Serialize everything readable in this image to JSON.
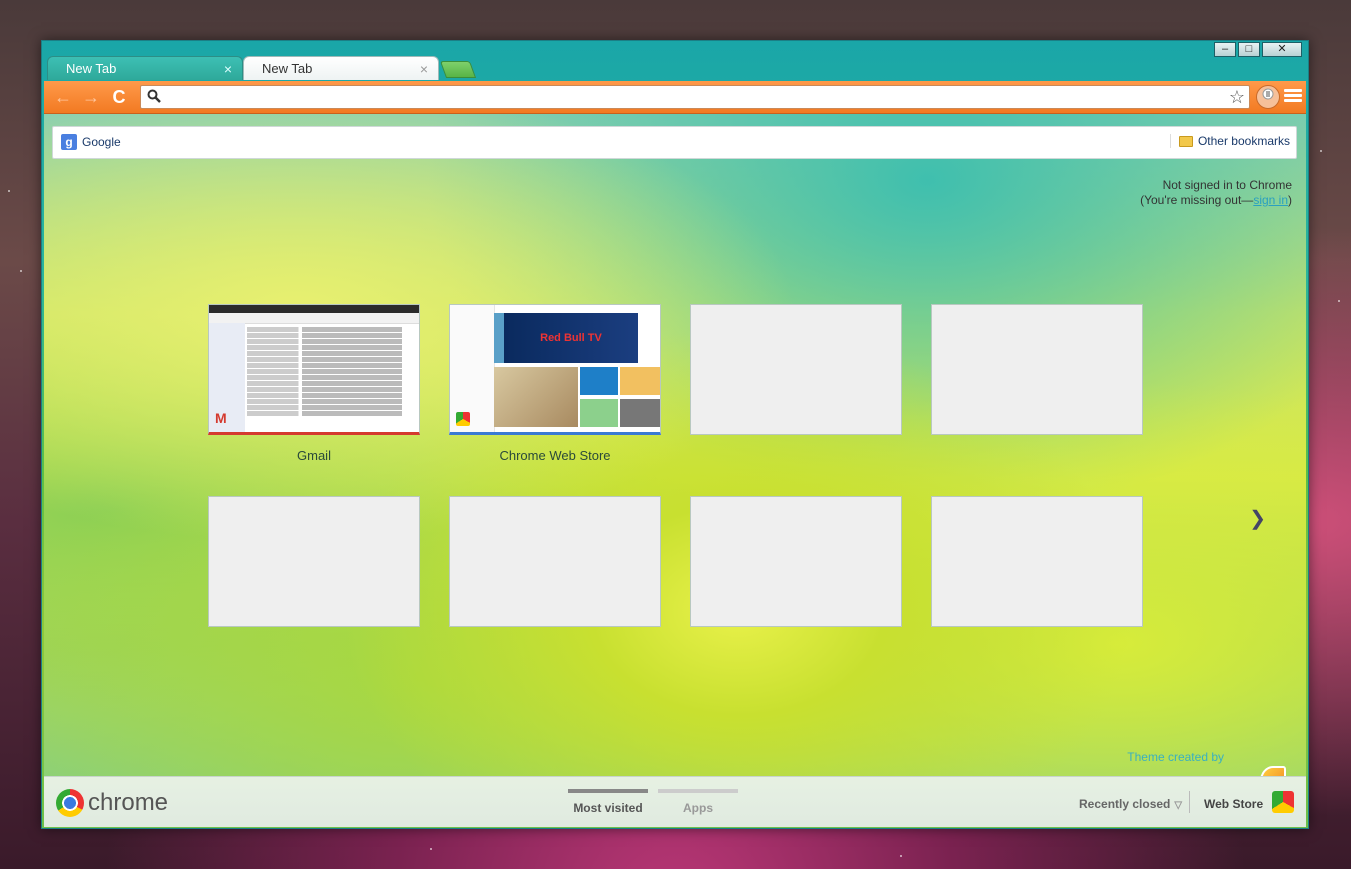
{
  "window": {
    "controls": {
      "minimize": "–",
      "maximize": "□",
      "close": "✕"
    }
  },
  "tabs": [
    {
      "label": "New Tab",
      "close": "×"
    },
    {
      "label": "New Tab",
      "close": "×"
    }
  ],
  "toolbar": {
    "back_icon": "←",
    "forward_icon": "→",
    "reload_icon": "C",
    "omnibox": {
      "value": "",
      "placeholder": ""
    },
    "star_icon": "☆"
  },
  "bookmarks": {
    "google": "Google",
    "google_logo": "g",
    "other": "Other bookmarks"
  },
  "signin": {
    "line1": "Not signed in to Chrome",
    "line2_prefix": "(You're missing out—",
    "link": "sign in",
    "line2_suffix": ")"
  },
  "most_visited": [
    {
      "title": "Gmail"
    },
    {
      "title": "Chrome Web Store"
    }
  ],
  "cws_banner": "Red Bull TV",
  "gmail_logo": "M",
  "next_arrow": "❯",
  "theme_credit": "Theme created by",
  "footer": {
    "brand": "chrome",
    "most_visited": "Most visited",
    "apps": "Apps",
    "recently_closed": "Recently closed",
    "caret": "▽",
    "web_store": "Web Store"
  }
}
